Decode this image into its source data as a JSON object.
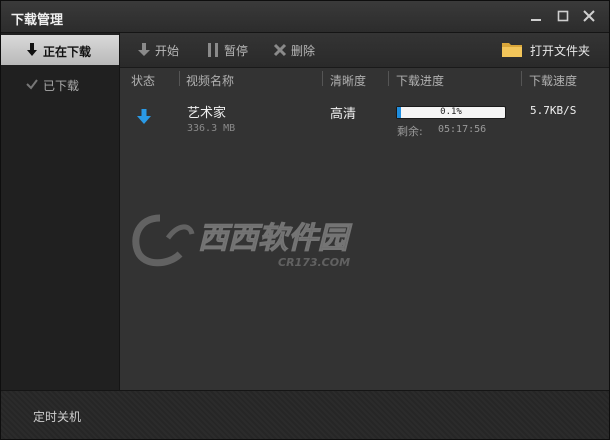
{
  "window": {
    "title": "下载管理"
  },
  "sidebar": {
    "items": [
      {
        "label": "正在下载",
        "icon": "arrow-down-icon",
        "active": true
      },
      {
        "label": "已下载",
        "icon": "checkmark-icon",
        "active": false
      }
    ]
  },
  "toolbar": {
    "start_label": "开始",
    "pause_label": "暂停",
    "delete_label": "删除",
    "open_folder_label": "打开文件夹"
  },
  "table": {
    "columns": [
      "状态",
      "视频名称",
      "清晰度",
      "下载进度",
      "下载速度"
    ],
    "rows": [
      {
        "status_icon": "download-arrow-icon",
        "name": "艺术家",
        "size": "336.3 MB",
        "quality": "高清",
        "progress_text": "0.1%",
        "progress": 0.001,
        "remaining_label": "剩余:",
        "remaining_time": "05:17:56",
        "speed": "5.7KB/S"
      }
    ]
  },
  "watermark": {
    "brand": "西西软件园",
    "domain": "CR173.COM"
  },
  "footer": {
    "shutdown_label": "定时关机"
  },
  "colors": {
    "accent": "#1e8ee0",
    "folder": "#e8b84a"
  }
}
